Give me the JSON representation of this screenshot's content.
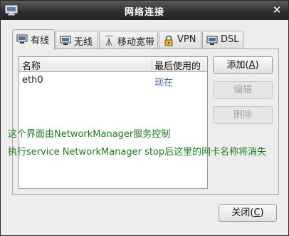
{
  "window": {
    "title": "网络连接",
    "close_glyph": "✕"
  },
  "tabs": [
    {
      "label": "有线",
      "icon": "wired-icon"
    },
    {
      "label": "无线",
      "icon": "wireless-icon"
    },
    {
      "label": "移动宽带",
      "icon": "mobile-broadband-icon"
    },
    {
      "label": "VPN",
      "icon": "lock-icon"
    },
    {
      "label": "DSL",
      "icon": "dsl-icon"
    }
  ],
  "list": {
    "col_name": "名称",
    "col_last_used": "最后使用的",
    "rows": [
      {
        "name": "eth0",
        "last_used": "现在"
      }
    ]
  },
  "buttons": {
    "add": {
      "text": "添加(",
      "key": "A",
      "tail": ")"
    },
    "edit": "编辑",
    "delete": "删除",
    "close": {
      "text": "关闭(",
      "key": "C",
      "tail": ")"
    }
  },
  "annotations": [
    "这个界面由NetworkManager服务控制",
    "执行service NetworkManager stop后这里的网卡名称将消失"
  ],
  "colors": {
    "annotation": "#1f7a1f",
    "last_used_text": "#4a6ea0"
  }
}
